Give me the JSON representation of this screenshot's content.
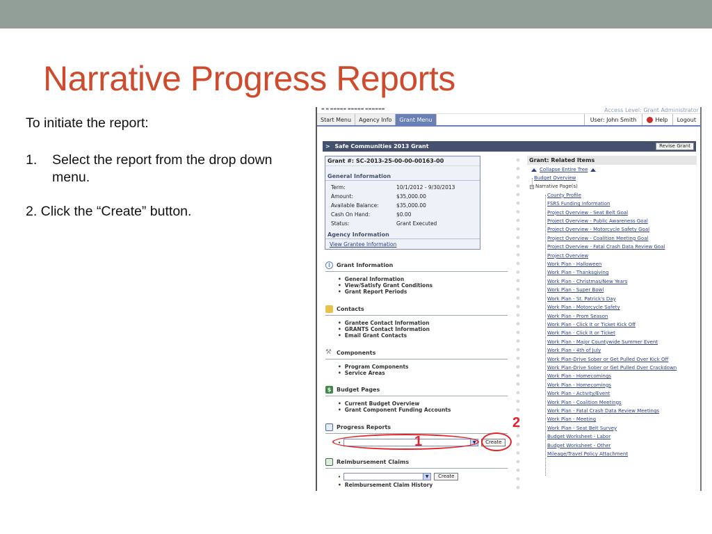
{
  "slide": {
    "title": "Narrative Progress Reports",
    "intro": "To initiate the report:",
    "step1_num": "1.",
    "step1_text": "Select the report from the drop down menu.",
    "step2": "2.  Click the “Create” button.",
    "marker1": "1",
    "marker2": "2",
    "accent_color": "#cf4b2e",
    "highlight_color": "#e3232a"
  },
  "app": {
    "access_level": "Access Level: Grant Administrator",
    "nav_tabs": [
      "Start Menu",
      "Agency Info",
      "Grant Menu"
    ],
    "active_tab": "Grant Menu",
    "user": "User: John Smith",
    "help": "Help",
    "logout": "Logout",
    "grant_title": "Safe Communities 2013 Grant",
    "revise_button": "Revise Grant"
  },
  "grant_box": {
    "heading": "Grant #: SC-2013-25-00-00-00163-00",
    "general_heading": "General Information",
    "rows": [
      {
        "label": "Term:",
        "value": "10/1/2012 - 9/30/2013"
      },
      {
        "label": "Amount:",
        "value": "$35,000.00"
      },
      {
        "label": "Available Balance:",
        "value": "$35,000.00"
      },
      {
        "label": "Cash On Hand:",
        "value": "$0.00"
      },
      {
        "label": "Status:",
        "value": "Grant Executed"
      }
    ],
    "agency_heading": "Agency Information",
    "agency_link": "View Grantee Information"
  },
  "sections": {
    "grant_info": {
      "title": "Grant Information",
      "items": [
        "General Information",
        "View/Satisfy Grant Conditions",
        "Grant Report Periods"
      ]
    },
    "contacts": {
      "title": "Contacts",
      "items": [
        "Grantee Contact Information",
        "GRANTS Contact Information",
        "Email Grant Contacts"
      ]
    },
    "components": {
      "title": "Components",
      "items": [
        "Program Components",
        "Service Areas"
      ]
    },
    "budget": {
      "title": "Budget Pages",
      "items": [
        "Current Budget Overview",
        "Grant Component Funding Accounts"
      ]
    },
    "progress": {
      "title": "Progress Reports",
      "create": "Create"
    },
    "reimburse": {
      "title": "Reimbursement Claims",
      "create": "Create",
      "items": [
        "Reimbursement Claim History"
      ]
    }
  },
  "related": {
    "heading": "Grant: Related Items",
    "collapse": "Collapse Entire Tree",
    "budget_overview": "Budget Overview",
    "narrative": "Narrative Page(s)",
    "items": [
      "County Profile",
      "FSRS Funding Information",
      "Project Overview - Seat Belt Goal",
      "Project Overview - Public Awareness Goal",
      "Project Overview - Motorcycle Safety Goal",
      "Project Overview - Coalition Meeting Goal",
      "Project Overview - Fatal Crash Data Review Goal",
      "Project Overview",
      "Work Plan - Halloween",
      "Work Plan - Thanksgiving",
      "Work Plan - Christmas/New Years",
      "Work Plan - Super Bowl",
      "Work Plan - St. Patrick's Day",
      "Work Plan - Motorcycle Safety",
      "Work Plan - Prom Season",
      "Work Plan - Click It or Ticket Kick Off",
      "Work Plan - Click It or Ticket",
      "Work Plan - Major Countywide Summer Event",
      "Work Plan - 4th of July",
      "Work Plan-Drive Sober or Get Pulled Over Kick Off",
      "Work Plan-Drive Sober or Get Pulled Over Crackdown",
      "Work Plan - Homecomings",
      "Work Plan - Homecomings",
      "Work Plan - Activity/Event",
      "Work Plan - Coalition Meetings",
      "Work Plan - Fatal Crash Data Review Meetings",
      "Work Plan - Meeting",
      "Work Plan - Seat Belt Survey",
      "Budget Worksheet - Labor",
      "Budget Worksheet - Other",
      "Mileage/Travel Policy Attachment"
    ]
  }
}
